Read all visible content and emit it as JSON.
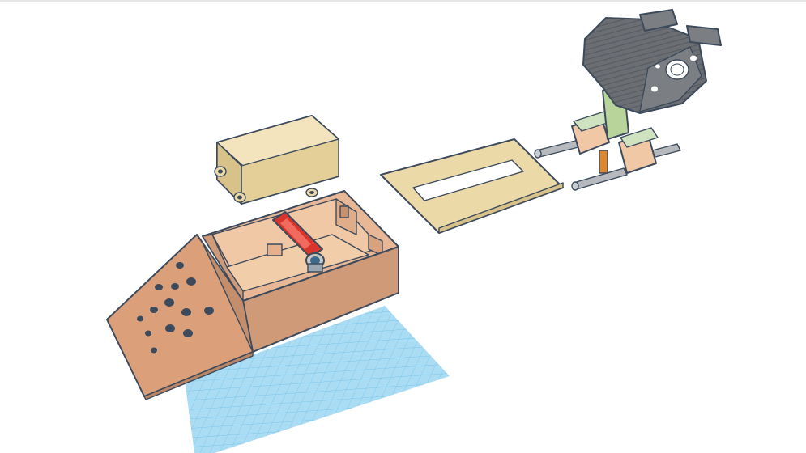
{
  "scene": {
    "background_color": "#ffffff",
    "workplane_color": "#8fd0ef",
    "workplane_grid_color": "#5fb7e0",
    "objects": [
      {
        "name": "enclosure-lid",
        "color": "#ecd9a8"
      },
      {
        "name": "control-box",
        "color": "#d9a583"
      },
      {
        "name": "button-panel",
        "color": "#dba07a"
      },
      {
        "name": "servo-arm",
        "color": "#d9342b"
      },
      {
        "name": "mounting-plate",
        "color": "#ecd9a8"
      },
      {
        "name": "camera-head",
        "color": "#6b6f74"
      },
      {
        "name": "support-column",
        "color": "#b9d49a"
      },
      {
        "name": "guide-rod",
        "color": "#a8acb0"
      }
    ]
  }
}
